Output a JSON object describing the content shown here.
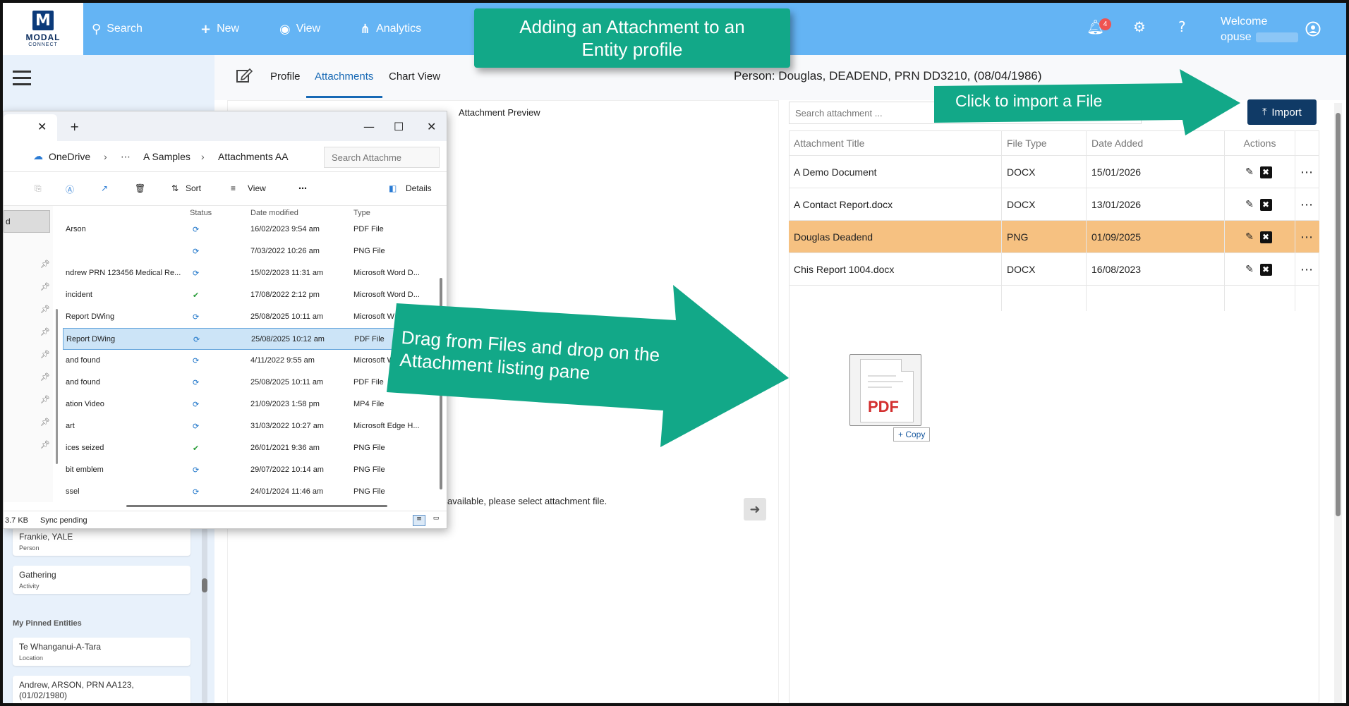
{
  "app": {
    "logo_text": "MODAL",
    "logo_sub": "CONNECT"
  },
  "topnav": {
    "search": "Search",
    "new": "New",
    "view": "View",
    "analytics": "Analytics",
    "notifications_count": "4",
    "welcome": "Welcome",
    "username": "opuse"
  },
  "callouts": {
    "title": "Adding an Attachment to an Entity profile",
    "import_hint": "Click to import a File",
    "drag_hint": "Drag from Files and drop on the Attachment listing pane"
  },
  "tabs": {
    "profile": "Profile",
    "attachments": "Attachments",
    "chart_view": "Chart View"
  },
  "person_header": "Person: Douglas, DEADEND, PRN DD3210, (08/04/1986)",
  "preview": {
    "title": "Attachment Preview",
    "message": "available, please select attachment file."
  },
  "attachments": {
    "search_placeholder": "Search attachment ...",
    "import_label": "Import",
    "columns": {
      "title": "Attachment Title",
      "file_type": "File Type",
      "date_added": "Date Added",
      "actions": "Actions"
    },
    "rows": [
      {
        "title": "A Demo Document",
        "type": "DOCX",
        "date": "15/01/2026",
        "highlighted": false
      },
      {
        "title": "A Contact Report.docx",
        "type": "DOCX",
        "date": "13/01/2026",
        "highlighted": false
      },
      {
        "title": "Douglas Deadend",
        "type": "PNG",
        "date": "01/09/2025",
        "highlighted": true
      },
      {
        "title": "Chis Report 1004.docx",
        "type": "DOCX",
        "date": "16/08/2023",
        "highlighted": false
      }
    ]
  },
  "drag_ghost": {
    "label": "PDF",
    "copy_label": "+ Copy"
  },
  "sidebar": {
    "recent": [
      {
        "title": "Frankie, YALE",
        "kind": "Person"
      },
      {
        "title": "Gathering",
        "kind": "Activity"
      }
    ],
    "pinned_heading": "My Pinned Entities",
    "pinned": [
      {
        "title": "Te Whanganui-A-Tara",
        "kind": "Location"
      },
      {
        "title": "Andrew, ARSON, PRN AA123, (01/02/1980)",
        "kind": ""
      }
    ]
  },
  "explorer": {
    "breadcrumb": [
      "OneDrive",
      "A Samples",
      "Attachments AA"
    ],
    "search_placeholder": "Search Attachme",
    "toolbar": {
      "sort": "Sort",
      "view": "View",
      "details": "Details"
    },
    "nav_selected": "d",
    "columns": {
      "status": "Status",
      "date_modified": "Date modified",
      "type": "Type"
    },
    "files": [
      {
        "name": "Arson",
        "status": "sync",
        "date": "16/02/2023 9:54 am",
        "type": "PDF File"
      },
      {
        "name": "",
        "status": "sync",
        "date": "7/03/2022 10:26 am",
        "type": "PNG File"
      },
      {
        "name": "ndrew PRN 123456 Medical Re...",
        "status": "sync",
        "date": "15/02/2023 11:31 am",
        "type": "Microsoft Word D..."
      },
      {
        "name": "incident",
        "status": "ok",
        "date": "17/08/2022 2:12 pm",
        "type": "Microsoft Word D..."
      },
      {
        "name": "Report DWing",
        "status": "sync",
        "date": "25/08/2025 10:11 am",
        "type": "Microsoft W"
      },
      {
        "name": "Report DWing",
        "status": "sync",
        "date": "25/08/2025 10:12 am",
        "type": "PDF File",
        "selected": true
      },
      {
        "name": "and found",
        "status": "sync",
        "date": "4/11/2022 9:55 am",
        "type": "Microsoft W"
      },
      {
        "name": "and found",
        "status": "sync",
        "date": "25/08/2025 10:11 am",
        "type": "PDF File"
      },
      {
        "name": "ation Video",
        "status": "sync",
        "date": "21/09/2023 1:58 pm",
        "type": "MP4 File"
      },
      {
        "name": "art",
        "status": "sync",
        "date": "31/03/2022 10:27 am",
        "type": "Microsoft Edge H..."
      },
      {
        "name": "ices seized",
        "status": "ok",
        "date": "26/01/2021 9:36 am",
        "type": "PNG File"
      },
      {
        "name": "bit emblem",
        "status": "sync",
        "date": "29/07/2022 10:14 am",
        "type": "PNG File"
      },
      {
        "name": "ssel",
        "status": "sync",
        "date": "24/01/2024 11:46 am",
        "type": "PNG File"
      }
    ],
    "status_size": "3.7 KB",
    "status_sync": "Sync pending"
  },
  "colors": {
    "topbar": "#64b4f4",
    "callout": "#12a888",
    "import_button": "#103a66",
    "highlight_row": "#f6c181",
    "tab_active": "#1769b5"
  }
}
